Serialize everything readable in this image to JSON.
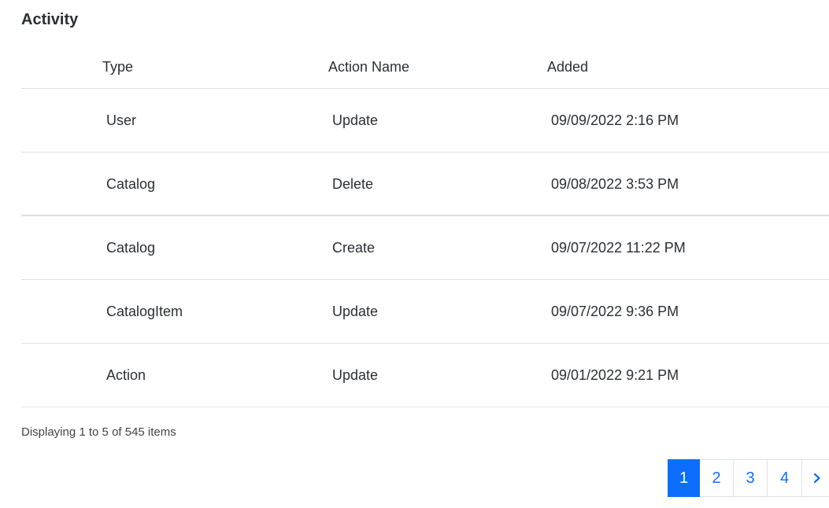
{
  "section": {
    "title": "Activity"
  },
  "table": {
    "columns": [
      "Type",
      "Action Name",
      "Added"
    ],
    "rows": [
      [
        "User",
        "Update",
        "09/09/2022 2:16 PM"
      ],
      [
        "Catalog",
        "Delete",
        "09/08/2022 3:53 PM"
      ],
      [
        "Catalog",
        "Create",
        "09/07/2022 11:22 PM"
      ],
      [
        "CatalogItem",
        "Update",
        "09/07/2022 9:36 PM"
      ],
      [
        "Action",
        "Update",
        "09/01/2022 9:21 PM"
      ]
    ]
  },
  "summary": "Displaying 1 to 5 of 545 items",
  "pagination": {
    "pages": [
      "1",
      "2",
      "3",
      "4"
    ],
    "current": "1",
    "next_icon": "chevron-right-icon"
  },
  "colors": {
    "accent": "#0d6efd",
    "text": "#2b2f33",
    "border": "#dee2e6"
  }
}
